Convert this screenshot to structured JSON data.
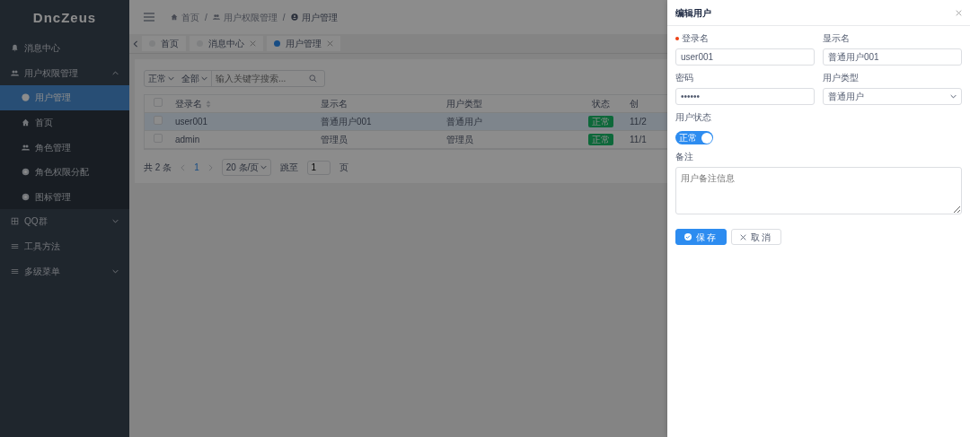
{
  "sidebar": {
    "logo": "DncZeus",
    "items": [
      {
        "label": "消息中心",
        "kind": "link",
        "selected": false
      },
      {
        "label": "用户权限管理",
        "kind": "group",
        "expanded": true,
        "selected": false,
        "children": [
          {
            "label": "用户管理",
            "selected": true
          },
          {
            "label": "首页",
            "selected": false
          },
          {
            "label": "角色管理",
            "selected": false
          },
          {
            "label": "角色权限分配",
            "selected": false
          },
          {
            "label": "图标管理",
            "selected": false
          }
        ]
      },
      {
        "label": "QQ群",
        "kind": "group",
        "expanded": false,
        "selected": false
      },
      {
        "label": "工具方法",
        "kind": "link",
        "selected": false
      },
      {
        "label": "多级菜单",
        "kind": "group",
        "expanded": false,
        "selected": false
      }
    ]
  },
  "breadcrumb": [
    {
      "label": "首页",
      "current": false
    },
    {
      "label": "用户权限管理",
      "current": false
    },
    {
      "label": "用户管理",
      "current": true
    }
  ],
  "breadcrumb_separator": "/",
  "tabs": [
    {
      "label": "首页",
      "selected": false,
      "closable": false
    },
    {
      "label": "消息中心",
      "selected": false,
      "closable": true
    },
    {
      "label": "用户管理",
      "selected": true,
      "closable": true
    }
  ],
  "filter": {
    "status": "正常",
    "type": "全部",
    "placeholder": "输入关键字搜索..."
  },
  "table": {
    "columns": [
      {
        "label": "登录名",
        "sortable": true,
        "kind": "text"
      },
      {
        "label": "显示名",
        "sortable": false,
        "kind": "text"
      },
      {
        "label": "用户类型",
        "sortable": false,
        "kind": "text"
      },
      {
        "label": "状态",
        "sortable": false,
        "kind": "badge"
      },
      {
        "label": "创",
        "sortable": false,
        "kind": "text"
      }
    ],
    "all_checked": false,
    "rows": [
      {
        "selected": true,
        "checked": false,
        "cells": [
          "user001",
          "普通用户001",
          "普通用户",
          "正常",
          "11/2"
        ]
      },
      {
        "selected": false,
        "checked": false,
        "cells": [
          "admin",
          "管理员",
          "管理员",
          "正常",
          "11/1"
        ]
      }
    ]
  },
  "pagination": {
    "total": "共 2 条",
    "pages": [
      {
        "label": "1",
        "selected": true
      }
    ],
    "page_size": "20 条/页",
    "goto_label": "跳至",
    "goto_value": "1",
    "page_suffix": "页"
  },
  "drawer": {
    "title": "编辑用户",
    "fields": [
      {
        "label": "登录名",
        "required": true,
        "kind": "input",
        "value": "user001"
      },
      {
        "label": "显示名",
        "required": false,
        "kind": "input",
        "value": "普通用户001"
      },
      {
        "label": "密码",
        "required": false,
        "kind": "input",
        "value": "••••••"
      },
      {
        "label": "用户类型",
        "required": false,
        "kind": "select",
        "value": "普通用户"
      },
      {
        "label": "用户状态",
        "required": false,
        "kind": "switch",
        "on": true,
        "text": "正常"
      },
      {
        "label": "备注",
        "required": false,
        "kind": "textarea",
        "placeholder": "用户备注信息"
      }
    ],
    "buttons": [
      {
        "label": "保存",
        "kind": "primary"
      },
      {
        "label": "取消",
        "kind": "default"
      }
    ]
  }
}
